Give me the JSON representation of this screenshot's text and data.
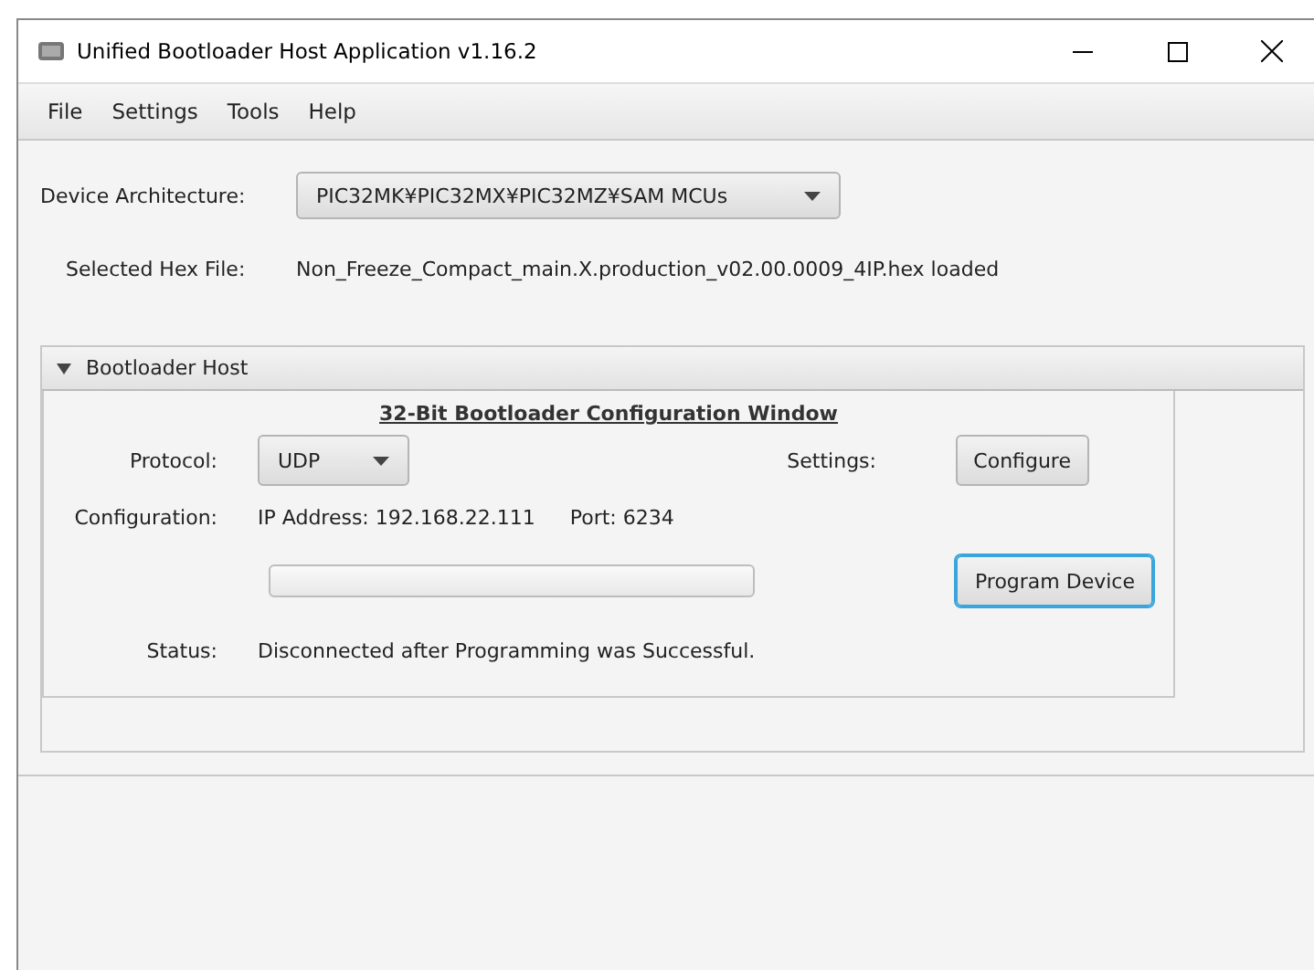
{
  "window": {
    "title": "Unified Bootloader Host Application v1.16.2"
  },
  "menu": [
    "File",
    "Settings",
    "Tools",
    "Help"
  ],
  "device_architecture": {
    "label": "Device Architecture:",
    "value": "PIC32MK¥PIC32MX¥PIC32MZ¥SAM MCUs"
  },
  "hex_file": {
    "label": "Selected Hex File:",
    "value": "Non_Freeze_Compact_main.X.production_v02.00.0009_4IP.hex loaded"
  },
  "bootloader_host": {
    "title": "Bootloader Host",
    "expanded": true,
    "heading": "32-Bit Bootloader Configuration Window",
    "protocol": {
      "label": "Protocol:",
      "value": "UDP"
    },
    "settings": {
      "label": "Settings:",
      "button": "Configure"
    },
    "configuration": {
      "label": "Configuration:",
      "ip": "IP Address: 192.168.22.111",
      "port": "Port: 6234"
    },
    "progress": {
      "level": 0
    },
    "program_button": "Program Device",
    "status": {
      "label": "Status:",
      "value": "Disconnected after Programming was Successful."
    }
  }
}
